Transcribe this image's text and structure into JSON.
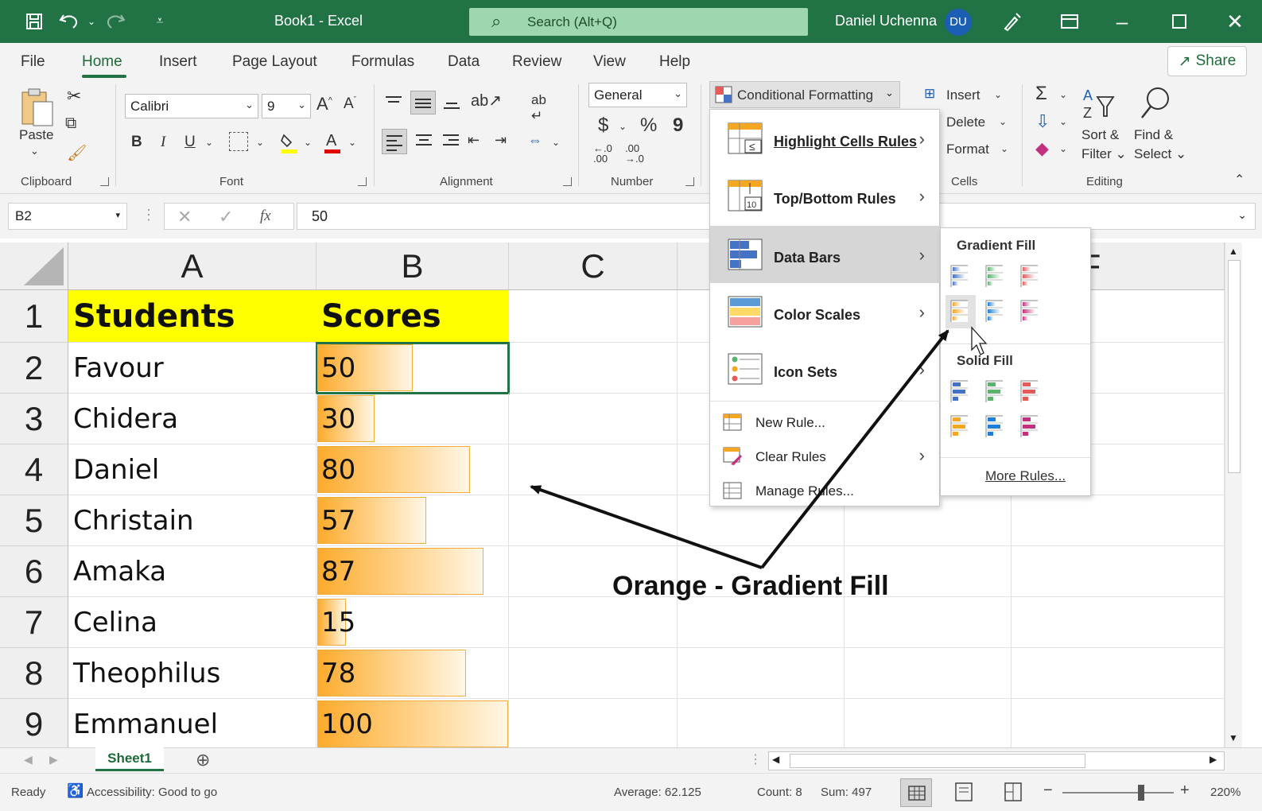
{
  "titlebar": {
    "doc_title": "Book1  -  Excel",
    "search_placeholder": "Search (Alt+Q)",
    "user_name": "Daniel Uchenna",
    "user_initials": "DU",
    "accent": "#217346"
  },
  "tabs": [
    "File",
    "Home",
    "Insert",
    "Page Layout",
    "Formulas",
    "Data",
    "Review",
    "View",
    "Help"
  ],
  "share_label": "Share",
  "ribbon": {
    "clipboard": {
      "paste": "Paste",
      "label": "Clipboard"
    },
    "font": {
      "name": "Calibri",
      "size": "9",
      "bold": "B",
      "italic": "I",
      "underline": "U",
      "label": "Font"
    },
    "alignment": {
      "label": "Alignment"
    },
    "number": {
      "format": "General",
      "currency": "$",
      "percent": "%",
      "comma": "9",
      "label": "Number"
    },
    "styles": {
      "conditional_formatting": "Conditional Formatting"
    },
    "cells": {
      "insert": "Insert",
      "delete": "Delete",
      "format": "Format",
      "label": "Cells"
    },
    "editing": {
      "sort_filter_1": "Sort &",
      "sort_filter_2": "Filter",
      "find_select_1": "Find &",
      "find_select_2": "Select",
      "label": "Editing"
    }
  },
  "formula_bar": {
    "name_box": "B2",
    "fx": "fx",
    "value": "50"
  },
  "grid": {
    "columns": [
      "A",
      "B",
      "C",
      "F"
    ],
    "rows": [
      "1",
      "2",
      "3",
      "4",
      "5",
      "6",
      "7",
      "8",
      "9"
    ],
    "header": {
      "students": "Students",
      "scores": "Scores"
    },
    "records": [
      {
        "student": "Favour",
        "score": "50"
      },
      {
        "student": "Chidera",
        "score": "30"
      },
      {
        "student": "Daniel",
        "score": "80"
      },
      {
        "student": "Christain",
        "score": "57"
      },
      {
        "student": "Amaka",
        "score": "87"
      },
      {
        "student": "Celina",
        "score": "15"
      },
      {
        "student": "Theophilus",
        "score": "78"
      },
      {
        "student": "Emmanuel",
        "score": "100"
      }
    ],
    "highlight_color": "#ffff00",
    "bar_color": "#fcab2d"
  },
  "cf_menu": {
    "items": [
      {
        "label": "Highlight Cells Rules",
        "icon": "highlight-cells-icon"
      },
      {
        "label": "Top/Bottom Rules",
        "icon": "top-bottom-icon"
      },
      {
        "label": "Data Bars",
        "icon": "data-bars-icon"
      },
      {
        "label": "Color Scales",
        "icon": "color-scales-icon"
      },
      {
        "label": "Icon Sets",
        "icon": "icon-sets-icon"
      }
    ],
    "new_rule": "New Rule...",
    "clear_rules": "Clear Rules",
    "manage_rules": "Manage Rules..."
  },
  "data_bars_menu": {
    "gradient_fill": "Gradient Fill",
    "solid_fill": "Solid Fill",
    "more_rules": "More Rules...",
    "colors": [
      "#4472c4",
      "#5ab46e",
      "#e35b5b",
      "#f5a623",
      "#1f7fd8",
      "#c2307f"
    ]
  },
  "callout": "Orange - Gradient Fill",
  "sheet_tab": "Sheet1",
  "status": {
    "ready": "Ready",
    "accessibility": "Accessibility: Good to go",
    "average": "Average: 62.125",
    "count": "Count: 8",
    "sum": "Sum: 497",
    "zoom": "220%"
  }
}
